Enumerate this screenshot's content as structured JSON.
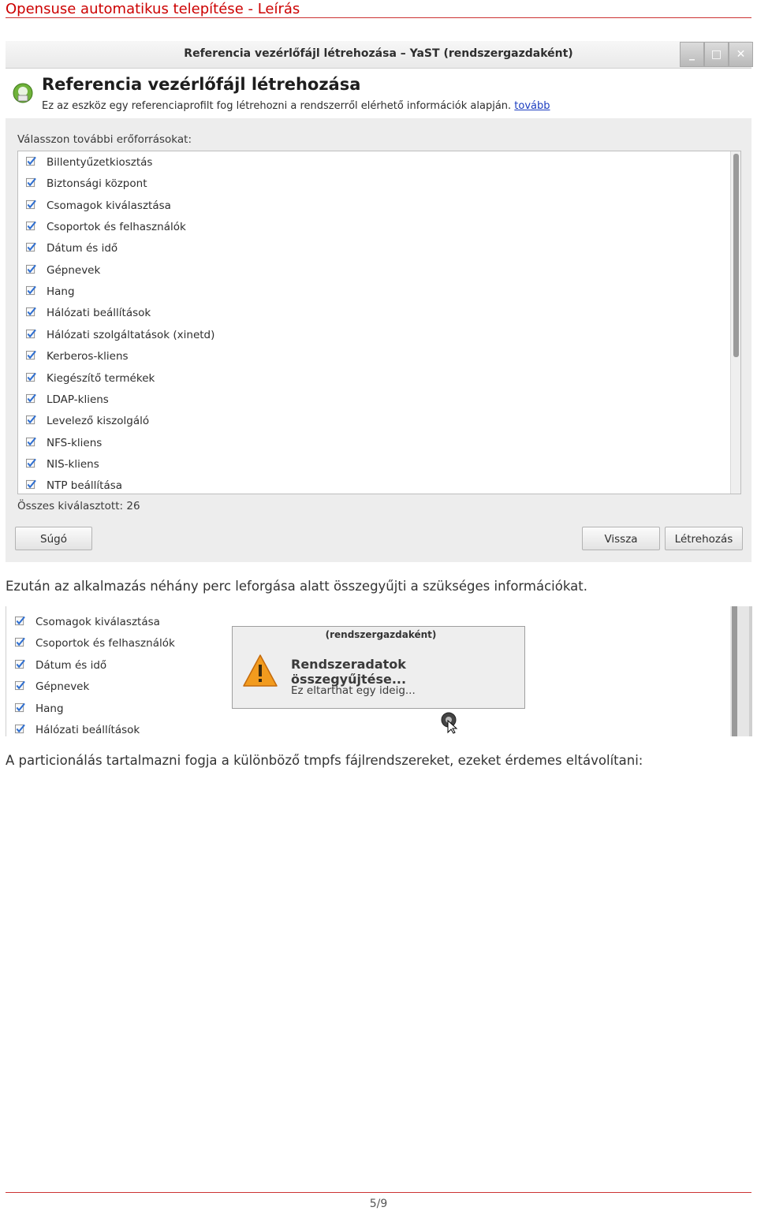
{
  "document": {
    "title": "Opensuse automatikus telepítése - Leírás",
    "page_number": "5/9"
  },
  "window": {
    "title": "Referencia vezérlőfájl létrehozása – YaST (rendszergazdaként)",
    "controls": {
      "minimize": "_",
      "maximize": "□",
      "close": "✕"
    },
    "header_title": "Referencia vezérlőfájl létrehozása",
    "header_desc": "Ez az eszköz egy referenciaprofilt fog létrehozni a rendszerről elérhető információk alapján.",
    "header_link": "tovább",
    "choose_label": "Válasszon további erőforrásokat:",
    "resources": [
      {
        "label": "Billentyűzetkiosztás",
        "checked": true
      },
      {
        "label": "Biztonsági központ",
        "checked": true
      },
      {
        "label": "Csomagok kiválasztása",
        "checked": true
      },
      {
        "label": "Csoportok és felhasználók",
        "checked": true
      },
      {
        "label": "Dátum és idő",
        "checked": true
      },
      {
        "label": "Gépnevek",
        "checked": true
      },
      {
        "label": "Hang",
        "checked": true
      },
      {
        "label": "Hálózati beállítások",
        "checked": true
      },
      {
        "label": "Hálózati szolgáltatások (xinetd)",
        "checked": true
      },
      {
        "label": "Kerberos-kliens",
        "checked": true
      },
      {
        "label": "Kiegészítő termékek",
        "checked": true
      },
      {
        "label": "LDAP-kliens",
        "checked": true
      },
      {
        "label": "Levelező kiszolgáló",
        "checked": true
      },
      {
        "label": "NFS-kliens",
        "checked": true
      },
      {
        "label": "NIS-kliens",
        "checked": true
      },
      {
        "label": "NTP beállítása",
        "checked": true
      }
    ],
    "total_selected": "Összes kiválasztott: 26",
    "buttons": {
      "help": "Súgó",
      "back": "Vissza",
      "create": "Létrehozás"
    }
  },
  "paragraph1": "Ezután az alkalmazás néhány perc leforgása alatt összegyűjti a szükséges információkat.",
  "screenshot2": {
    "resources": [
      {
        "label": "Csomagok kiválasztása",
        "checked": true
      },
      {
        "label": "Csoportok és felhasználók",
        "checked": true
      },
      {
        "label": "Dátum és idő",
        "checked": true
      },
      {
        "label": "Gépnevek",
        "checked": true
      },
      {
        "label": "Hang",
        "checked": true
      },
      {
        "label": "Hálózati beállítások",
        "checked": true
      }
    ],
    "dialog": {
      "title": "(rendszergazdaként)",
      "heading": "Rendszeradatok összegyűjtése...",
      "sub": "Ez eltarthat egy ideig..."
    }
  },
  "paragraph2": "A particionálás tartalmazni fogja a különböző tmpfs fájlrendszereket, ezeket érdemes eltávolítani:",
  "colors": {
    "title_red": "#cc0000",
    "link_blue": "#1a3cbf",
    "check_blue": "#2f6fd1"
  },
  "icons": {
    "app": "yast-autoinstall-icon",
    "warning": "warning-icon",
    "cursor": "busy-cursor-icon",
    "check": "checkmark-icon"
  }
}
